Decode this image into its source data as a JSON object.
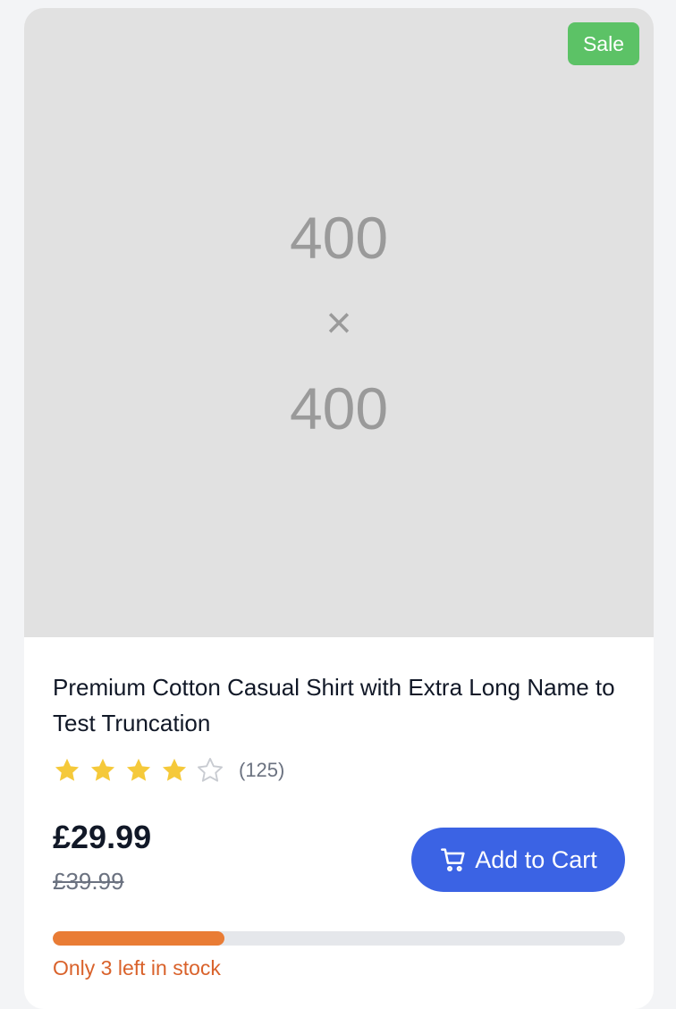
{
  "product": {
    "image_placeholder": {
      "line1": "400",
      "line2": "×",
      "line3": "400"
    },
    "badge": "Sale",
    "title": "Premium Cotton Casual Shirt with Extra Long Name to Test Truncation",
    "rating": {
      "value": 4,
      "max": 5,
      "count_label": "(125)"
    },
    "price": "£29.99",
    "original_price": "£39.99",
    "add_to_cart_label": "Add to Cart",
    "stock": {
      "message": "Only 3 left in stock",
      "level_fraction": 0.3
    }
  },
  "colors": {
    "badge": "#5cc266",
    "star_filled": "#f5c93a",
    "star_empty": "#c8cbd1",
    "button": "#3b63e4",
    "stock_fill": "#e97c35",
    "stock_text": "#d9622b"
  },
  "icons": {
    "star": "star-icon",
    "cart": "cart-icon"
  }
}
